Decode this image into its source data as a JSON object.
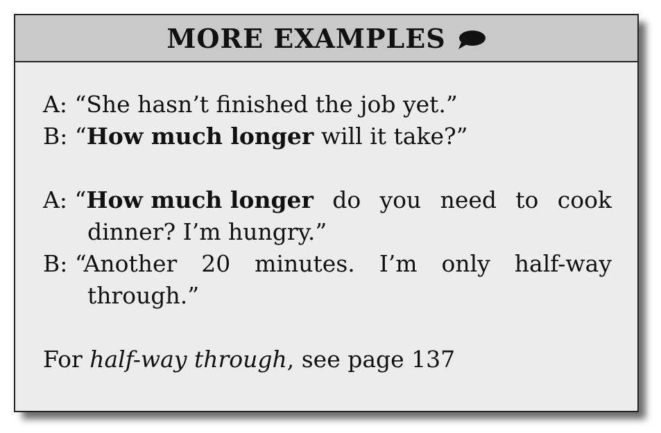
{
  "header": {
    "title": "MORE EXAMPLES",
    "icon": "speech-bubble-icon"
  },
  "example1": {
    "a_speaker": "A:",
    "a_text": "“She hasn’t finished the job yet.”",
    "b_speaker": "B:",
    "b_quote_open": "“",
    "b_bold": "How much longer",
    "b_rest": " will it take?”"
  },
  "example2": {
    "a_speaker": "A:",
    "a_quote_open": "“",
    "a_bold": "How much longer",
    "a_rest_words": [
      "do",
      "you",
      "need",
      "to",
      "cook"
    ],
    "a_line2": "dinner? I’m hungry.”",
    "b_speaker": "B:",
    "b_words": [
      "“Another",
      "20",
      "minutes.",
      "I’m",
      "only",
      "half-way"
    ],
    "b_line2": "through.”"
  },
  "footer": {
    "prefix": "For ",
    "italic": "half-way through",
    "suffix": ", see page 137"
  }
}
